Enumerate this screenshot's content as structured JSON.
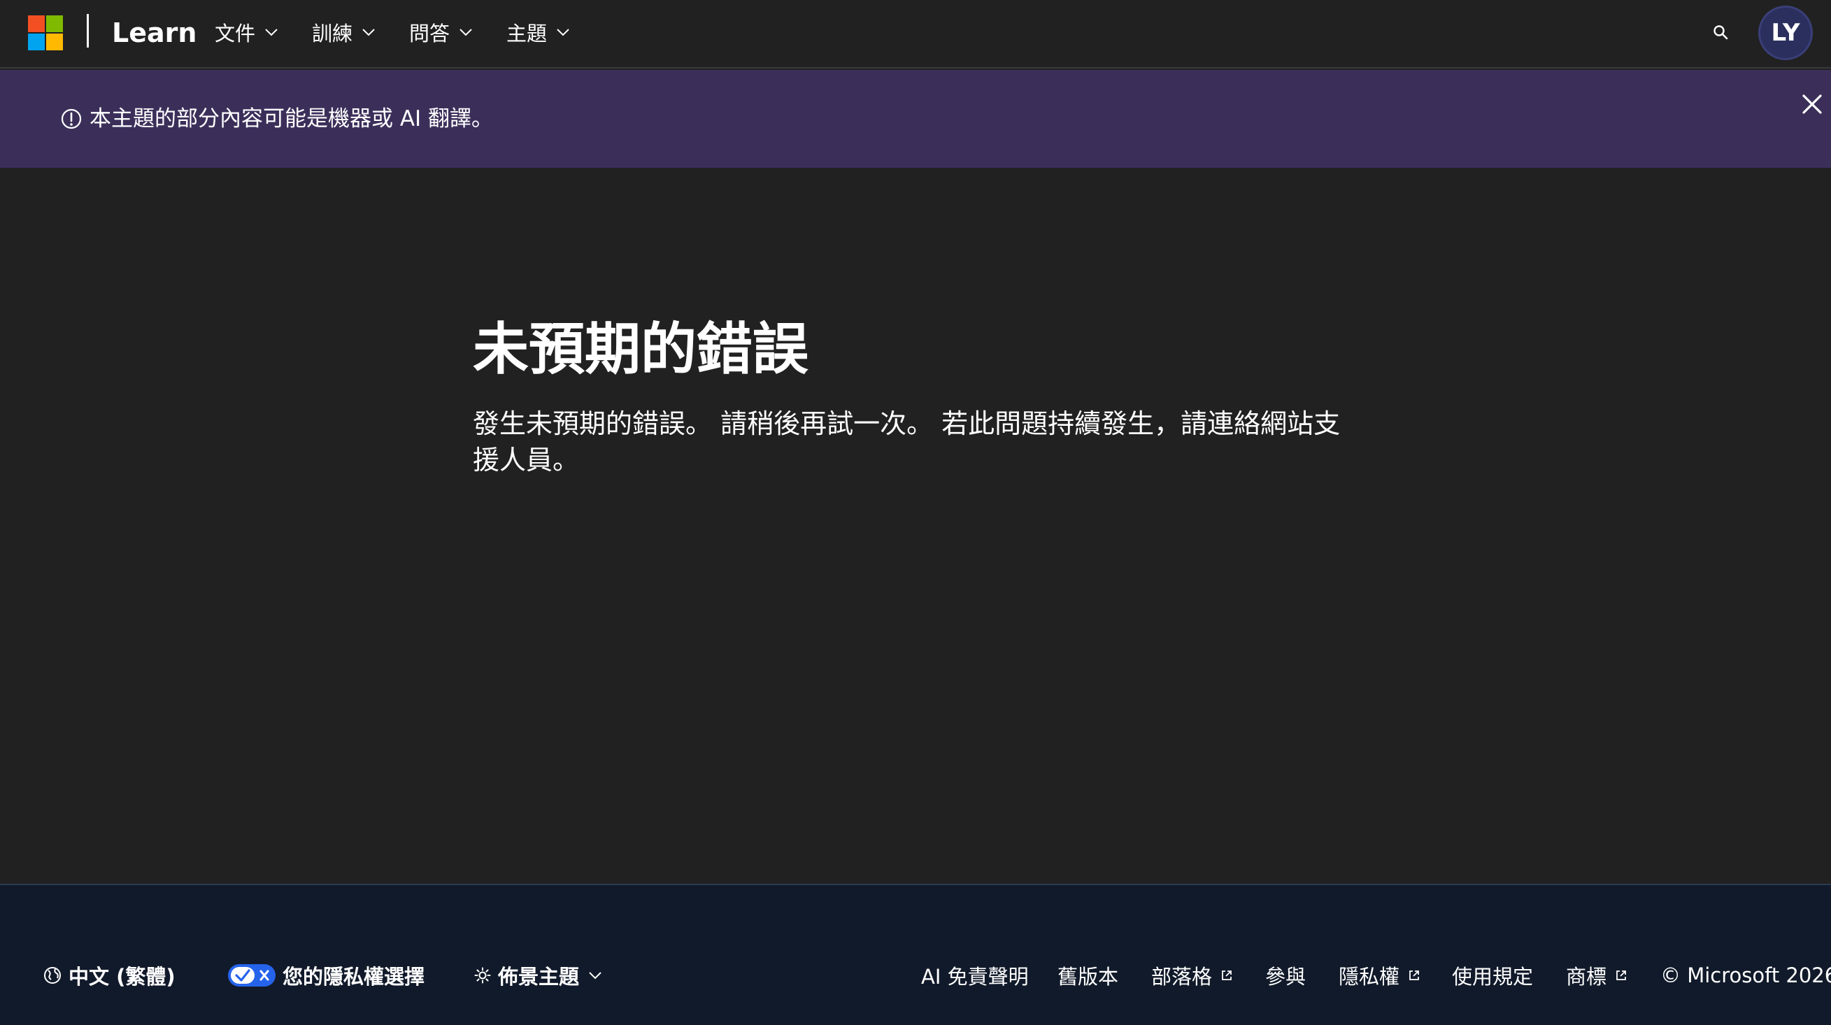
{
  "header": {
    "brand": "Learn",
    "nav": [
      {
        "label": "文件"
      },
      {
        "label": "訓練"
      },
      {
        "label": "問答"
      },
      {
        "label": "主題"
      }
    ],
    "avatar_initials": "LY",
    "logo_colors": [
      "#f25022",
      "#7fba00",
      "#00a4ef",
      "#ffb900"
    ]
  },
  "banner": {
    "text": "本主題的部分內容可能是機器或 AI 翻譯。",
    "icon": "info-circle-icon",
    "background": "#3b2f5a"
  },
  "main": {
    "title": "未預期的錯誤",
    "description": "發生未預期的錯誤。 請稍後再試一次。 若此問題持續發生，請連絡網站支援人員。"
  },
  "footer": {
    "language": "中文 (繁體)",
    "privacy": "您的隱私權選擇",
    "theme": "佈景主題",
    "links": [
      {
        "label": "AI 免責聲明",
        "external": false
      },
      {
        "label": "舊版本",
        "external": false
      },
      {
        "label": "部落格",
        "external": true
      },
      {
        "label": "參與",
        "external": false
      },
      {
        "label": "隱私權",
        "external": true
      },
      {
        "label": "使用規定",
        "external": false
      },
      {
        "label": "商標",
        "external": true
      }
    ],
    "copyright": "© Microsoft 2026"
  }
}
